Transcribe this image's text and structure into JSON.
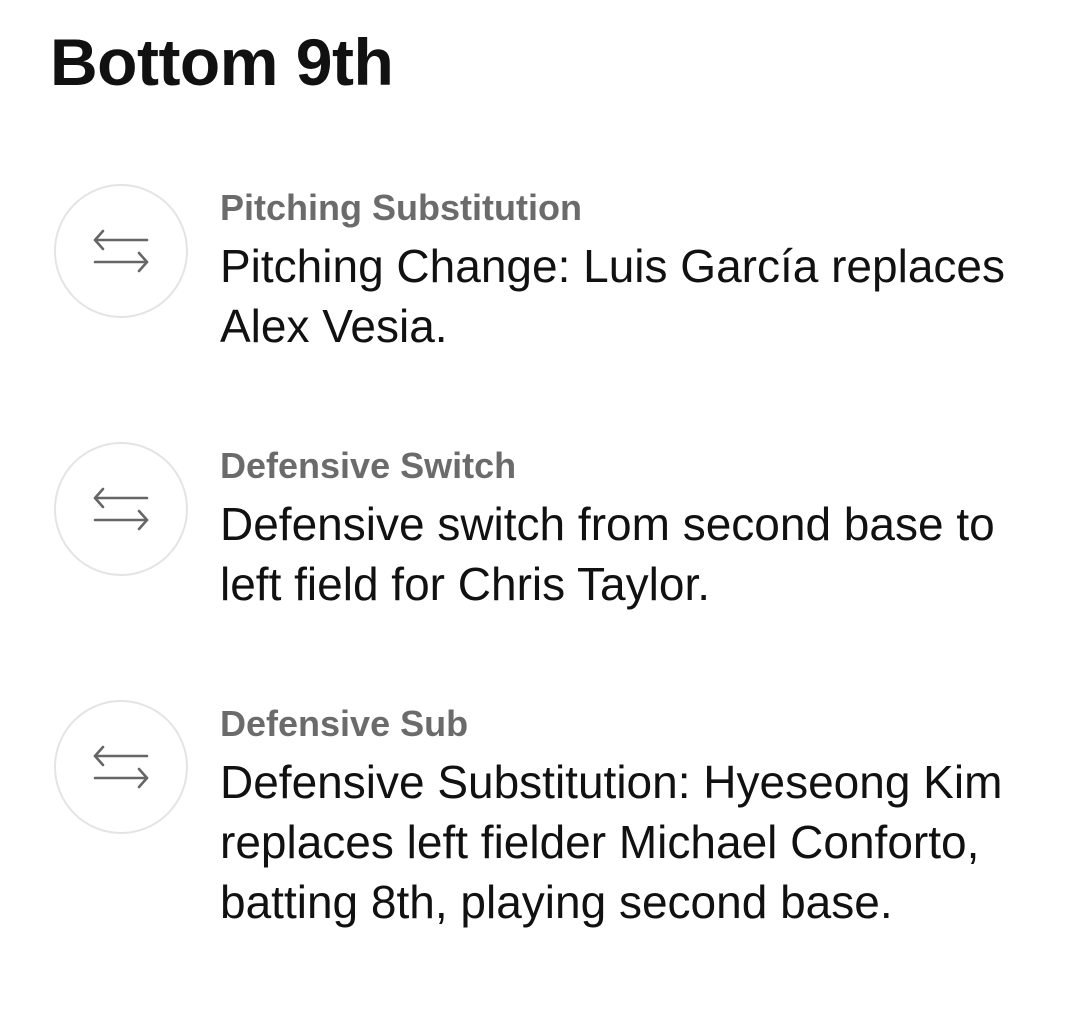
{
  "header": {
    "title": "Bottom 9th"
  },
  "events": [
    {
      "icon": "swap-arrows-icon",
      "type": "Pitching Substitution",
      "description": "Pitching Change: Luis García replaces Alex Vesia."
    },
    {
      "icon": "swap-arrows-icon",
      "type": "Defensive Switch",
      "description": "Defensive switch from second base to left field for Chris Taylor."
    },
    {
      "icon": "swap-arrows-icon",
      "type": "Defensive Sub",
      "description": "Defensive Substitution: Hyeseong Kim replaces left fielder Michael Conforto, batting 8th, playing second base."
    }
  ]
}
